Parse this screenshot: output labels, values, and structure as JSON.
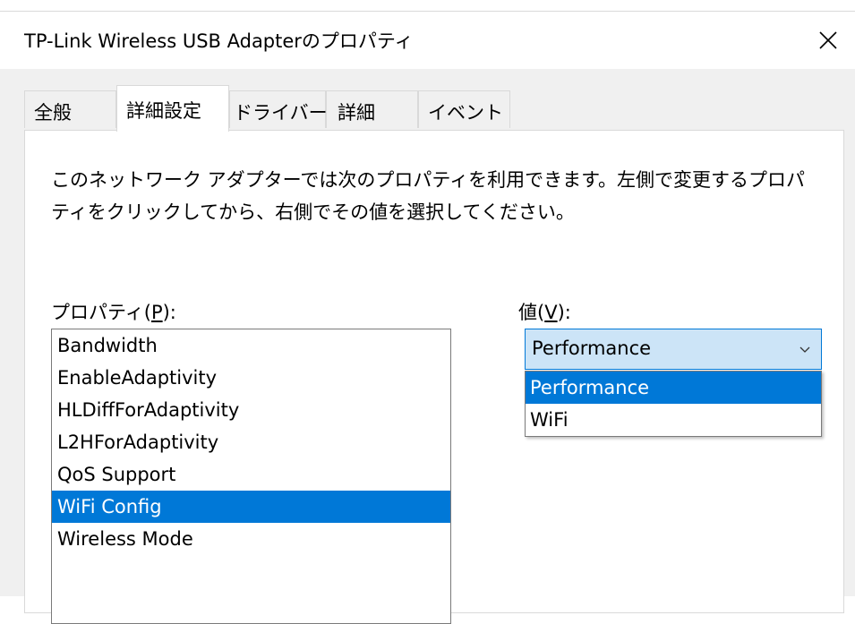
{
  "window": {
    "title": "TP-Link Wireless USB Adapterのプロパティ",
    "close_icon": "close-icon"
  },
  "tabs": [
    {
      "label": "全般"
    },
    {
      "label": "詳細設定",
      "active": true
    },
    {
      "label": "ドライバー"
    },
    {
      "label": "詳細"
    },
    {
      "label": "イベント"
    }
  ],
  "description": "このネットワーク アダプターでは次のプロパティを利用できます。左側で変更するプロパティをクリックしてから、右側でその値を選択してください。",
  "property_label": {
    "before": "プロパティ(",
    "key": "P",
    "after": "):"
  },
  "value_label": {
    "before": "値(",
    "key": "V",
    "after": "):"
  },
  "properties": [
    "Bandwidth",
    "EnableAdaptivity",
    "HLDiffForAdaptivity",
    "L2HForAdaptivity",
    "QoS Support",
    "WiFi Config",
    "Wireless Mode"
  ],
  "selected_property": "WiFi Config",
  "value_combo": {
    "selected": "Performance",
    "options": [
      "Performance",
      "WiFi"
    ]
  },
  "colors": {
    "selection": "#0078d7",
    "combo_bg": "#cce4f7"
  }
}
